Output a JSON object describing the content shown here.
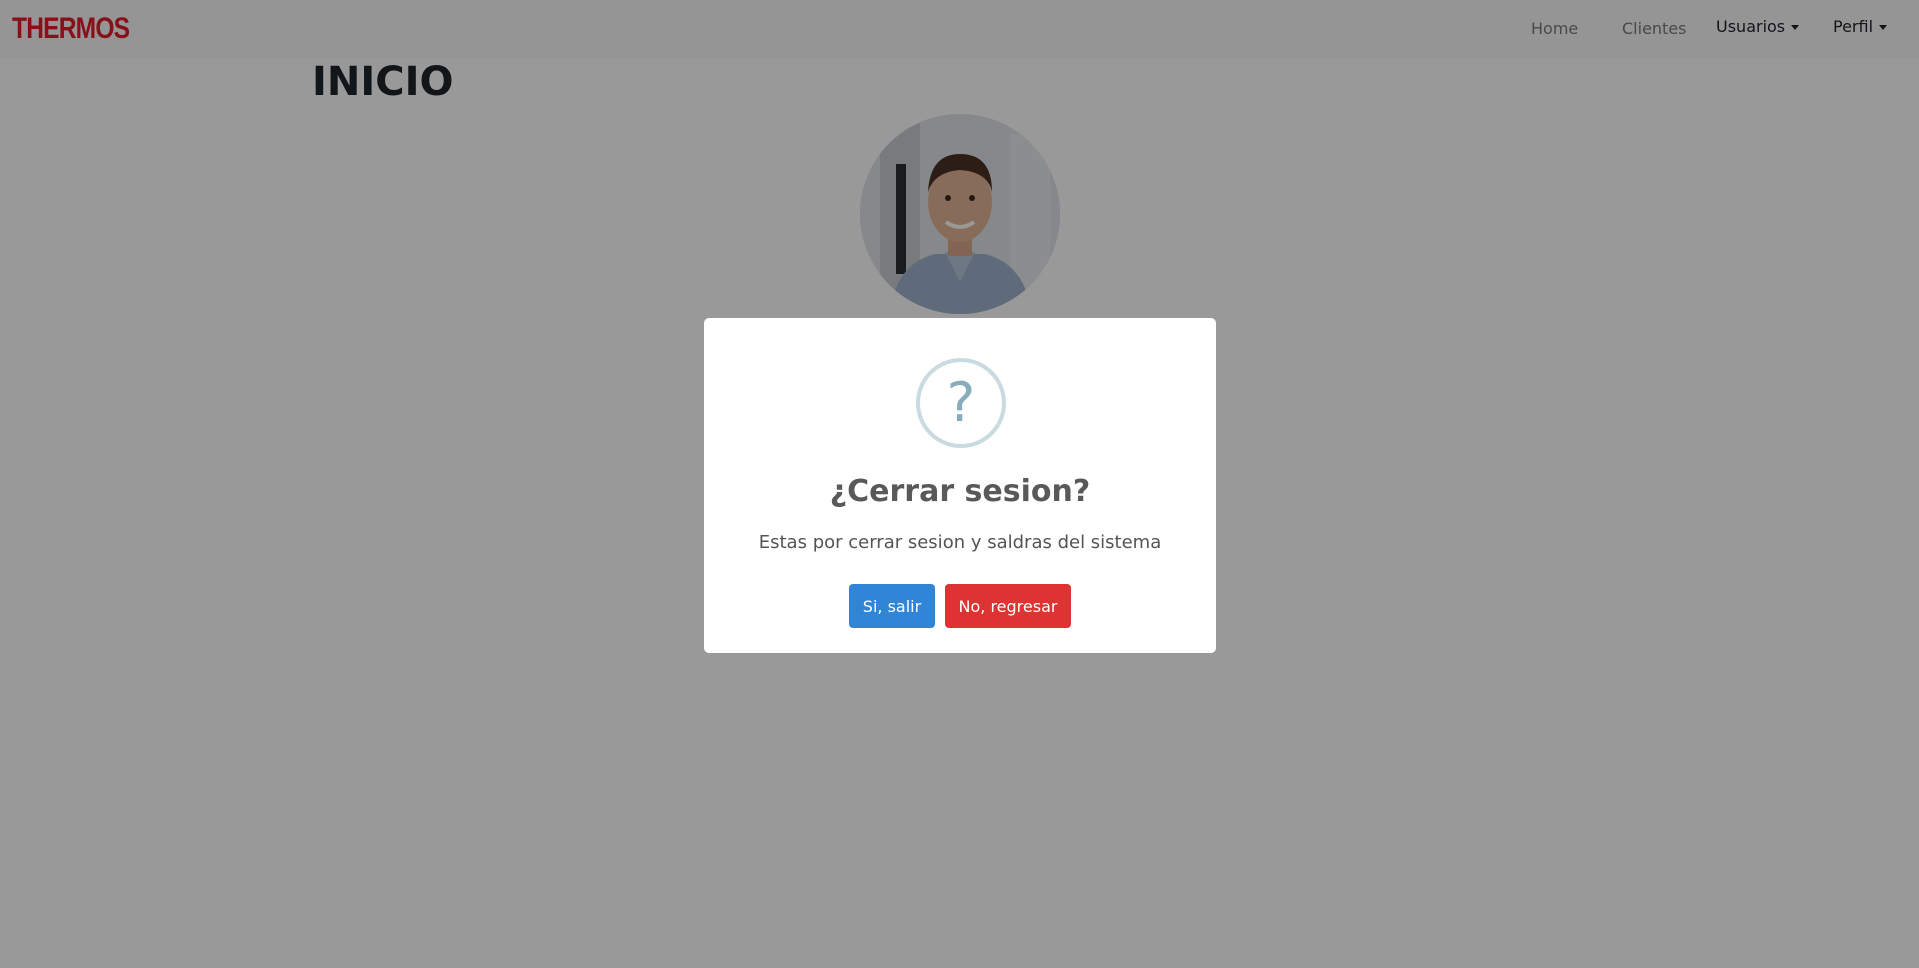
{
  "navbar": {
    "brand": "THERMOS",
    "links": [
      "Home",
      "Clientes"
    ],
    "dropdowns": [
      "Usuarios",
      "Perfil"
    ]
  },
  "main": {
    "title": "INICIO"
  },
  "modal": {
    "icon": "question-icon",
    "icon_glyph": "?",
    "title": "¿Cerrar sesion?",
    "text": "Estas por cerrar sesion y saldras del sistema",
    "confirm_label": "Si, salir",
    "cancel_label": "No, regresar"
  },
  "colors": {
    "brand": "#e21c2a",
    "confirm": "#3085d6",
    "cancel": "#dd3333",
    "question_icon": "#87adbd"
  }
}
